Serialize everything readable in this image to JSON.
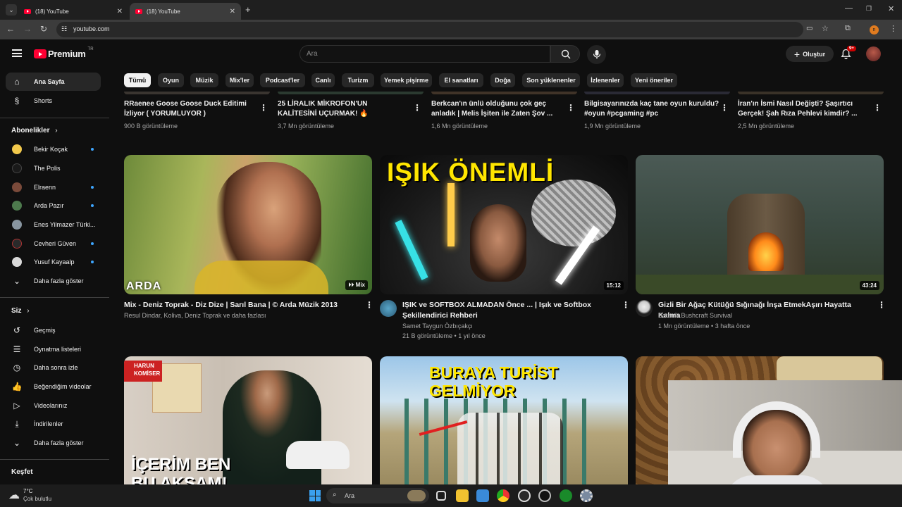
{
  "browser": {
    "tabs": [
      {
        "label": "(18) YouTube"
      },
      {
        "label": "(18) YouTube"
      }
    ],
    "url": "youtube.com"
  },
  "header": {
    "logo_text": "Premium",
    "logo_badge": "TR",
    "search_placeholder": "Ara",
    "create_label": "Oluştur",
    "notification_count": "9+"
  },
  "sidebar": {
    "main": [
      {
        "label": "Ana Sayfa"
      },
      {
        "label": "Shorts"
      }
    ],
    "subscriptions_title": "Abonelikler",
    "subscriptions": [
      {
        "label": "Bekir Koçak",
        "new": true,
        "color": "#f2c94c"
      },
      {
        "label": "The Polis",
        "new": false,
        "color": "#1a1a1a"
      },
      {
        "label": "Elraenn",
        "new": true,
        "color": "#7a4a3a"
      },
      {
        "label": "Arda Pazır",
        "new": true,
        "color": "#4d7a4d"
      },
      {
        "label": "Enes Yilmazer Türki...",
        "new": false,
        "color": "#8895a0"
      },
      {
        "label": "Cevheri Güven",
        "new": true,
        "color": "#2a2a2a"
      },
      {
        "label": "Yusuf Kayaalp",
        "new": true,
        "color": "#d9d9d9"
      }
    ],
    "subscriptions_more": "Daha fazla göster",
    "you_title": "Siz",
    "you_items": [
      {
        "label": "Geçmiş"
      },
      {
        "label": "Oynatma listeleri"
      },
      {
        "label": "Daha sonra izle"
      },
      {
        "label": "Beğendiğim videolar"
      },
      {
        "label": "Videolarınız"
      },
      {
        "label": "İndirilenler"
      },
      {
        "label": "Daha fazla göster"
      }
    ],
    "explore_title": "Keşfet"
  },
  "chips": [
    {
      "label": "Tümü",
      "selected": true
    },
    {
      "label": "Oyun",
      "selected": false
    },
    {
      "label": "Müzik",
      "selected": false
    },
    {
      "label": "Mix'ler",
      "selected": false
    },
    {
      "label": "Podcast'ler",
      "selected": false
    },
    {
      "label": "Canlı",
      "selected": false
    },
    {
      "label": "Turizm",
      "selected": false
    },
    {
      "label": "Yemek pişirme",
      "selected": false
    },
    {
      "label": "El sanatları",
      "selected": false
    },
    {
      "label": "Doğa",
      "selected": false
    },
    {
      "label": "Son yüklenenler",
      "selected": false
    },
    {
      "label": "İzlenenler",
      "selected": false
    },
    {
      "label": "Yeni öneriler",
      "selected": false
    }
  ],
  "top_row": [
    {
      "title1": "RRaenee Goose Goose Duck Editimi",
      "title2": "İzliyor ( YORUMLUYOR )",
      "views": "900 B görüntüleme"
    },
    {
      "title1": "25 LİRALIK MİKROFON'UN",
      "title2": "KALİTESİNİ UÇURMAK! 🔥",
      "views": "3,7 Mn görüntüleme"
    },
    {
      "title1": "Berkcan'ın ünlü olduğunu çok geç",
      "title2": "anladık | Melis İşiten ile Zaten Şov ...",
      "views": "1,6 Mn görüntüleme"
    },
    {
      "title1": "Bilgisayarınızda kaç tane oyun kuruldu?",
      "title2": "#oyun #pcgaming #pc",
      "views": "1,9 Mn görüntüleme"
    },
    {
      "title1": "İran'ın İsmi Nasıl Değişti? Şaşırtıcı",
      "title2": "Gerçek! Şah Rıza Pehlevi kimdir? ...",
      "views": "2,5 Mn görüntüleme"
    }
  ],
  "videos": [
    {
      "overlay": "ARDA",
      "badge": "Mix",
      "title1": "Mix - Deniz Toprak - Diz Dize | Sarıl Bana | © Arda Müzik 2013",
      "title2": "",
      "channel": "Resul Dindar, Koliva, Deniz Toprak ve daha fazlası",
      "stats": ""
    },
    {
      "overlay": "IŞIK ÖNEMLİ",
      "duration": "15:12",
      "title1": "IŞIK ve SOFTBOX ALMADAN Önce ... | Işık  ve Softbox",
      "title2": "Şekillendirici Rehberi",
      "channel": "Samet Taygun Özbıçakçı",
      "stats": "21 B görüntüleme • 1 yıl önce"
    },
    {
      "duration": "43:24",
      "title1": "Gizli Bir Ağaç Kütüğü Sığınağı İnşa EtmekAşırı Hayatta Kalma",
      "title2": "",
      "channel": "Botanik Bushcraft Survival",
      "stats": "1 Mn görüntüleme • 3 hafta önce"
    },
    {
      "overlay_top": "HARUN",
      "overlay_top2": "KOMİSER",
      "overlay": "İÇERİM BEN",
      "overlay2": "BU AKŞAM!"
    },
    {
      "overlay": "BURAYA TURİST",
      "overlay2": "GELMİYOR"
    },
    {}
  ],
  "taskbar": {
    "weather_temp": "7°C",
    "weather_desc": "Çok bulutlu",
    "search_placeholder": "Ara"
  }
}
